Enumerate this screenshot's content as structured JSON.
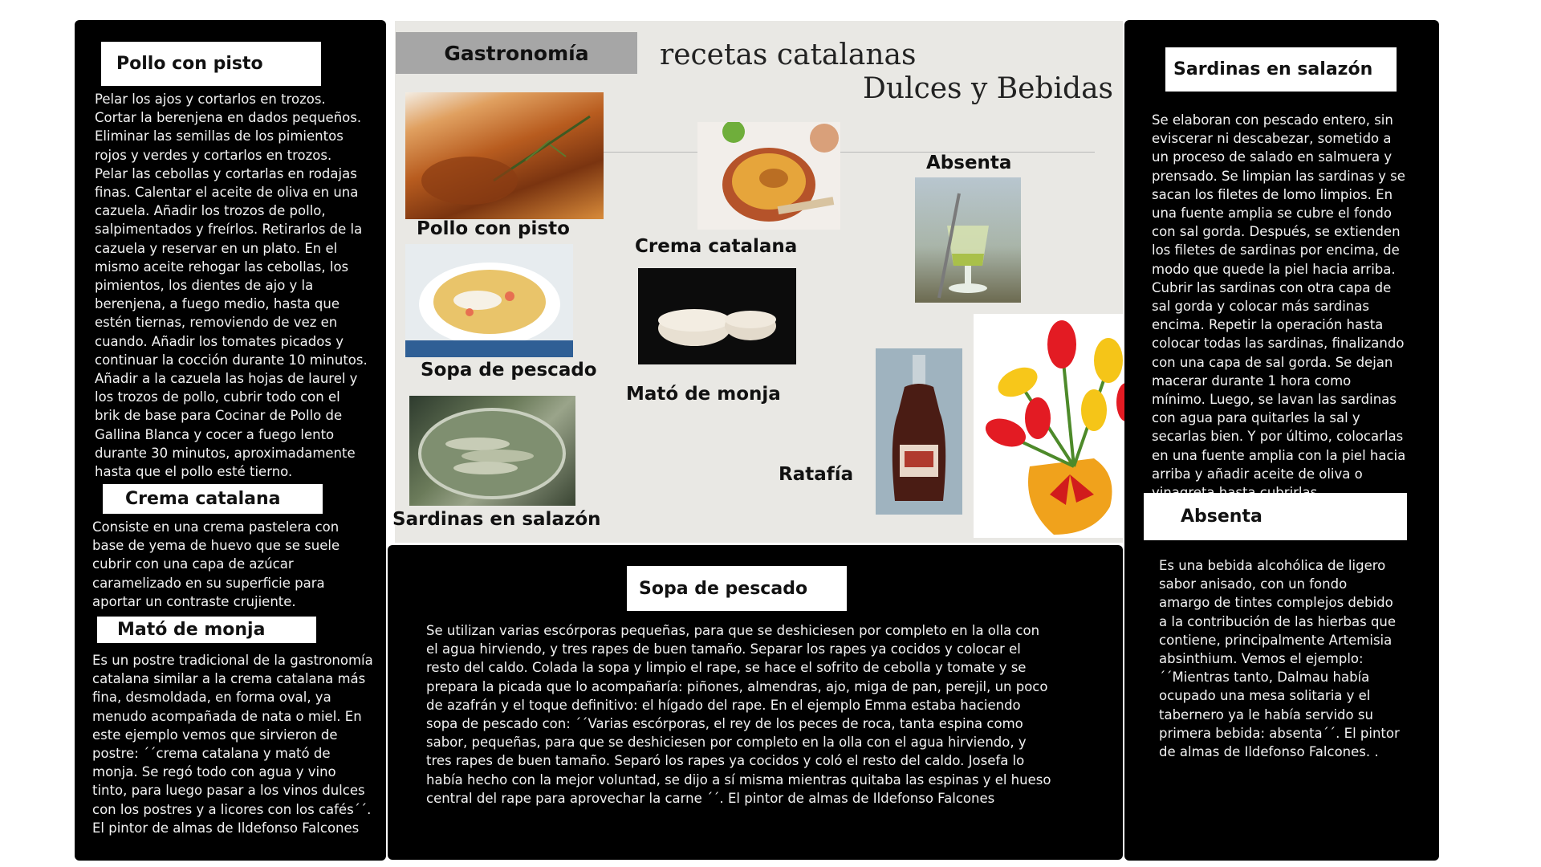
{
  "header": {
    "badge": "Gastronomía",
    "title": "recetas catalanas",
    "subtitle": "Dulces y Bebidas"
  },
  "left": {
    "pollo": {
      "title": "Pollo con pisto",
      "text": "Pelar los ajos y cortarlos en trozos. Cortar la berenjena en dados pequeños. Eliminar las semillas de los pimientos rojos y verdes y cortarlos en trozos. Pelar las cebollas y cortarlas en rodajas finas. Calentar el aceite de oliva en una cazuela. Añadir los trozos de pollo, salpimentados y freírlos. Retirarlos de la cazuela y reservar en un plato. En el mismo aceite rehogar las cebollas, los pimientos, los dientes de ajo y la berenjena, a fuego medio, hasta que estén tiernas, removiendo de vez en cuando. Añadir los tomates picados y continuar la cocción durante 10 minutos. Añadir a la cazuela las hojas de laurel y los trozos de pollo, cubrir todo con el brik de base para Cocinar de Pollo de Gallina Blanca y cocer a fuego lento durante 30 minutos, aproximadamente hasta que el pollo esté tierno."
    },
    "crema": {
      "title": "Crema catalana",
      "text": "Consiste en una crema pastelera con base de yema de huevo que se suele cubrir con una capa de azúcar caramelizado en su superficie para aportar un contraste crujiente."
    },
    "mato": {
      "title": "Mató de monja",
      "text": "Es un postre tradicional de la gastronomía catalana similar a la crema catalana más fina, desmoldada, en forma oval, ya menudo acompañada de nata o miel. En este ejemplo vemos que sirvieron de postre: ´´crema catalana y mató de monja. Se regó todo con agua y vino tinto, para luego pasar a los vinos dulces con los postres y a licores con los cafés´´.  El pintor de almas de Ildefonso Falcones"
    }
  },
  "center": {
    "labels": {
      "pollo": "Pollo con pisto",
      "sopa": "Sopa de pescado",
      "sardinas": "Sardinas en salazón",
      "crema": "Crema catalana",
      "mato": "Mató de monja",
      "absenta": "Absenta",
      "ratafia": "Ratafía"
    },
    "sopa": {
      "title": "Sopa de pescado",
      "text": "Se utilizan varias escórporas pequeñas, para que se deshiciesen por completo en la olla con el agua hirviendo, y tres rapes de buen tamaño. Separar los rapes ya cocidos y colocar el resto del caldo. Colada la sopa y limpio el rape, se hace el sofrito de cebolla y tomate y se prepara la picada que lo acompañaría: piñones, almendras, ajo, miga de pan, perejil, un poco de azafrán y el toque definitivo: el hígado del rape. En el ejemplo Emma estaba haciendo sopa de pescado con: ´´Varias escórporas, el rey de los peces de roca, tanta espina como sabor, pequeñas, para que se deshiciesen por completo en la olla con el agua hirviendo, y tres rapes de buen tamaño. Separó los rapes ya cocidos y coló el resto del caldo. Josefa lo había hecho con la mejor voluntad, se dijo a sí misma mientras quitaba las espinas y el hueso central del rape para aprovechar la carne ´´.  El pintor de almas de Ildefonso Falcones"
    }
  },
  "right": {
    "sardinas": {
      "title": "Sardinas en salazón",
      "text": "Se elaboran con pescado entero, sin eviscerar ni descabezar, sometido a un proceso de salado en salmuera y prensado. Se limpian las sardinas y se sacan los filetes de lomo limpios. En una fuente amplia se cubre el fondo con sal gorda. Después, se extienden los filetes de sardinas por encima, de modo que quede la piel hacia arriba. Cubrir las sardinas con otra capa de sal gorda y colocar más sardinas encima. Repetir la operación hasta colocar todas las sardinas, finalizando con una capa de sal gorda. Se dejan macerar durante 1 hora como mínimo. Luego, se lavan las sardinas con agua para quitarles la sal y secarlas bien.  Y por último, colocarlas en una fuente amplia con la piel hacia arriba y añadir aceite de oliva o vinagreta hasta cubrirlas"
    },
    "absenta": {
      "title": "Absenta",
      "text": "Es una bebida alcohólica de ligero sabor anisado, con un fondo amargo de tintes complejos debido a la contribución de las hierbas que contiene, principalmente Artemisia absinthium. Vemos el ejemplo: ´´Mientras tanto, Dalmau había ocupado una mesa solitaria y el tabernero ya le había servido su primera bebida: absenta´´. El pintor de almas de Ildefonso Falcones.  ."
    }
  },
  "icons": {
    "pollo_photo": "roast-chicken-photo-icon",
    "sopa_photo": "fish-soup-photo-icon",
    "sardinas_photo": "salted-sardines-photo-icon",
    "crema_photo": "crema-catalana-photo-icon",
    "mato_photo": "mato-cheese-photo-icon",
    "absenta_photo": "absinthe-glass-photo-icon",
    "ratafia_photo": "ratafia-bottle-photo-icon",
    "tulips": "tulip-bouquet-icon"
  },
  "colors": {
    "panel": "#000000",
    "center_bg": "#e9e8e4",
    "badge_bg": "#a6a6a6"
  }
}
